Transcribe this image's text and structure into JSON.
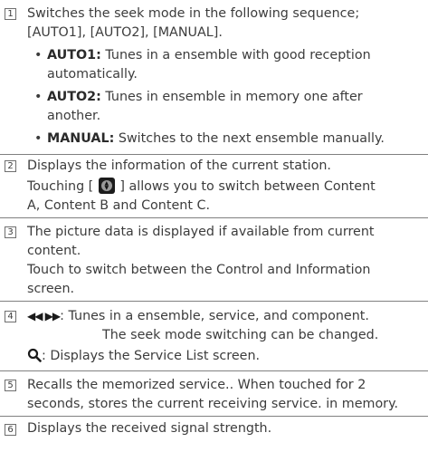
{
  "items": [
    {
      "num": "1",
      "intro": [
        "Switches the seek mode in the following sequence;",
        "[AUTO1], [AUTO2], [MANUAL]."
      ],
      "bullets": [
        {
          "bullet": "•",
          "term": "AUTO1:",
          "text": " Tunes in a ensemble with good reception",
          "cont": "automatically."
        },
        {
          "bullet": "•",
          "term": "AUTO2:",
          "text": " Tunes in ensemble in memory one after",
          "cont": "another."
        },
        {
          "bullet": "•",
          "term": "MANUAL:",
          "text": " Switches to the next ensemble manually."
        }
      ]
    },
    {
      "num": "2",
      "line1": "Displays the information of the current station.",
      "line2_pre": "Touching [ ",
      "line2_post": " ] allows you to switch between Content",
      "line3": "A, Content B and Content C.",
      "icon": "up-down-toggle-icon"
    },
    {
      "num": "3",
      "lines": [
        "The picture data is displayed if available from current",
        "content.",
        "Touch to switch between the Control and Information",
        "screen."
      ]
    },
    {
      "num": "4",
      "skip_glyph": "◀◀ ▶▶",
      "skip_icon": "skip-prev-next-icon",
      "line1": ": Tunes in a ensemble, service, and component.",
      "line2": "The seek mode switching can be changed.",
      "search_icon": "search-icon",
      "line3": ": Displays the Service List screen."
    },
    {
      "num": "5",
      "lines": [
        "Recalls the memorized service.. When touched for 2",
        "seconds, stores the current receiving service. in memory."
      ]
    },
    {
      "num": "6",
      "lines": [
        "Displays the received signal strength."
      ]
    }
  ]
}
